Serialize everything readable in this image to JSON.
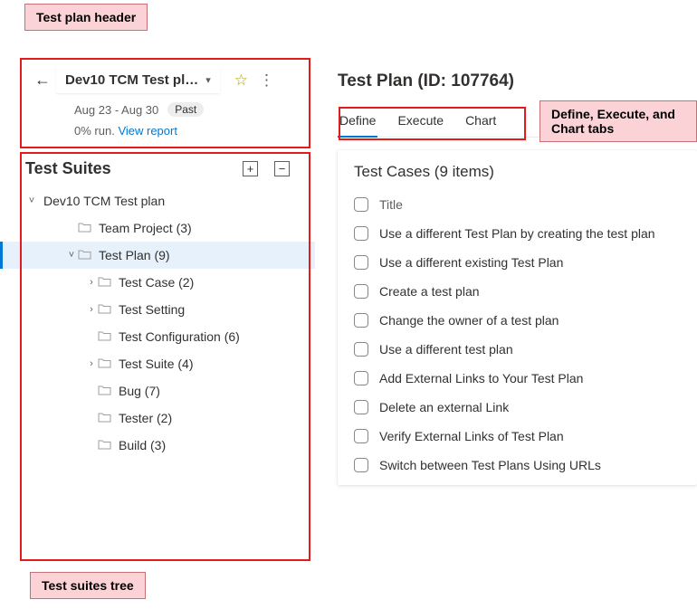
{
  "callouts": {
    "header": "Test plan header",
    "tree": "Test suites tree",
    "tabs": "Define, Execute, and Chart tabs"
  },
  "plan_header": {
    "title": "Dev10 TCM Test pl…",
    "date_range": "Aug 23 - Aug 30",
    "badge": "Past",
    "run_pct": "0% run.",
    "view_report": "View report"
  },
  "suites": {
    "title": "Test Suites",
    "root": "Dev10 TCM Test plan",
    "items": [
      {
        "label": "Team Project (3)",
        "indent": 2,
        "expand": ""
      },
      {
        "label": "Test Plan (9)",
        "indent": 2,
        "expand": "˅",
        "selected": true
      },
      {
        "label": "Test Case (2)",
        "indent": 3,
        "expand": "›"
      },
      {
        "label": "Test Setting",
        "indent": 3,
        "expand": "›"
      },
      {
        "label": "Test Configuration (6)",
        "indent": 3,
        "expand": ""
      },
      {
        "label": "Test Suite (4)",
        "indent": 3,
        "expand": "›"
      },
      {
        "label": "Bug (7)",
        "indent": 3,
        "expand": ""
      },
      {
        "label": "Tester (2)",
        "indent": 3,
        "expand": ""
      },
      {
        "label": "Build (3)",
        "indent": 3,
        "expand": ""
      }
    ]
  },
  "right": {
    "title": "Test Plan (ID: 107764)",
    "tabs": [
      "Define",
      "Execute",
      "Chart"
    ],
    "cases_title": "Test Cases (9 items)",
    "column_header": "Title",
    "cases": [
      "Use a different Test Plan by creating the test plan",
      "Use a different existing Test Plan",
      "Create a test plan",
      "Change the owner of a test plan",
      "Use a different test plan",
      "Add External Links to Your Test Plan",
      "Delete an external Link",
      "Verify External Links of Test Plan",
      "Switch between Test Plans Using URLs"
    ]
  }
}
